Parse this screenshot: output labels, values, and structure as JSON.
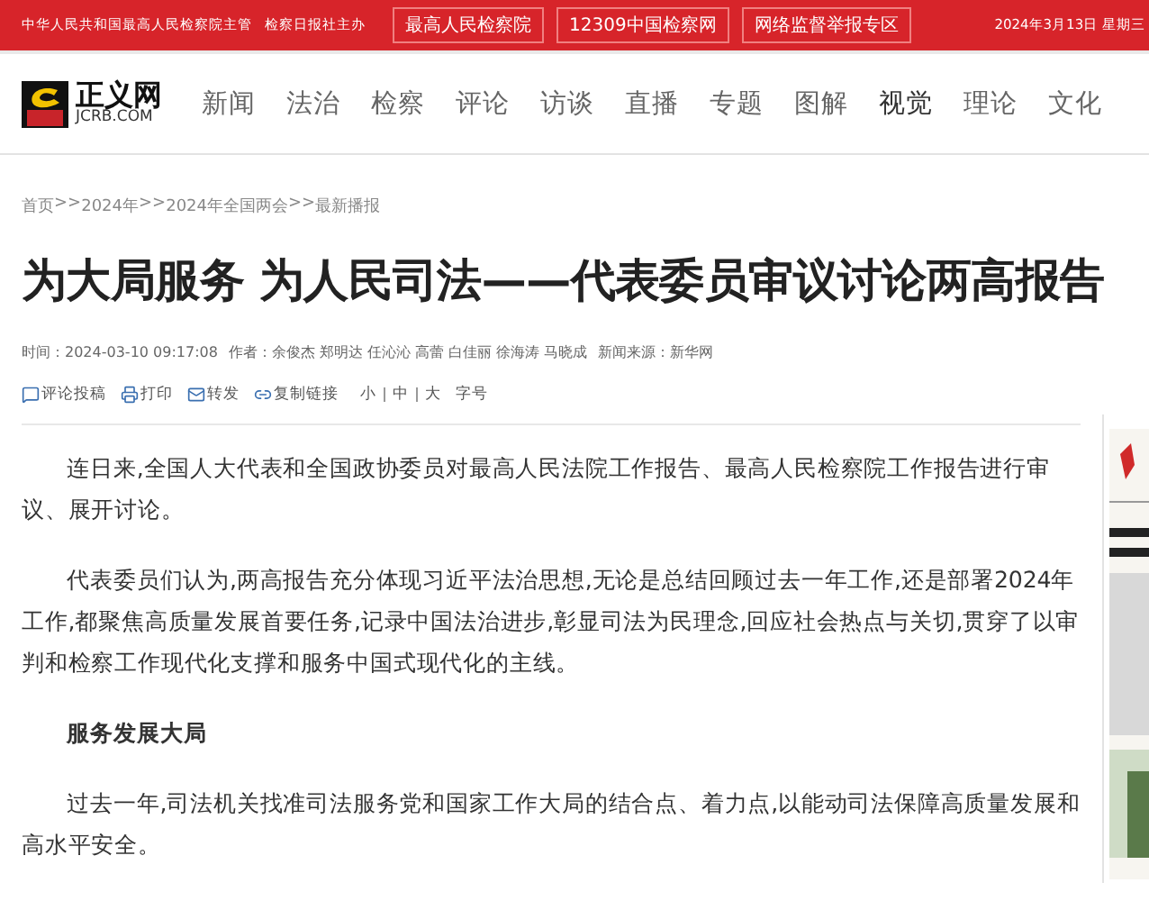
{
  "top_bar": {
    "texts": [
      "中华人民共和国最高人民检察院主管",
      "检察日报社主办"
    ],
    "links": [
      "最高人民检察院",
      "12309中国检察网",
      "网络监督举报专区"
    ],
    "date": "2024年3月13日 星期三"
  },
  "header": {
    "logo": {
      "name": "正义网",
      "domain": "JCRB.COM"
    },
    "nav": [
      {
        "label": "新闻",
        "selected": false
      },
      {
        "label": "法治",
        "selected": false
      },
      {
        "label": "检察",
        "selected": false
      },
      {
        "label": "评论",
        "selected": false
      },
      {
        "label": "访谈",
        "selected": false
      },
      {
        "label": "直播",
        "selected": false
      },
      {
        "label": "专题",
        "selected": false
      },
      {
        "label": "图解",
        "selected": false
      },
      {
        "label": "视觉",
        "selected": true
      },
      {
        "label": "理论",
        "selected": false
      },
      {
        "label": "文化",
        "selected": false
      }
    ]
  },
  "breadcrumb": [
    "首页",
    ">>",
    "2024年",
    ">>",
    "2024年全国两会",
    ">>",
    "最新播报"
  ],
  "article": {
    "title": "为大局服务 为人民司法——代表委员审议讨论两高报告",
    "meta": [
      "时间：2024-03-10 09:17:08",
      "作者：余俊杰 郑明达 任沁沁 高蕾 白佳丽 徐海涛 马晓成",
      "新闻来源：新华网"
    ],
    "tools": [
      {
        "kind": "comment",
        "label": "评论投稿"
      },
      {
        "kind": "print",
        "label": "打印"
      },
      {
        "kind": "mail",
        "label": "转发"
      },
      {
        "kind": "link",
        "label": "复制链接"
      }
    ],
    "font_sizes": [
      {
        "label": "小"
      },
      {
        "label": "中"
      },
      {
        "label": "大"
      }
    ],
    "font_size_label": "字号",
    "body": [
      {
        "kind": "para",
        "text": "连日来,全国人大代表和全国政协委员对最高人民法院工作报告、最高人民检察院工作报告进行审议、展开讨论。"
      },
      {
        "kind": "para",
        "text": "代表委员们认为,两高报告充分体现习近平法治思想,无论是总结回顾过去一年工作,还是部署2024年工作,都聚焦高质量发展首要任务,记录中国法治进步,彰显司法为民理念,回应社会热点与关切,贯穿了以审判和检察工作现代化支撑和服务中国式现代化的主线。"
      },
      {
        "kind": "heading",
        "text": "服务发展大局"
      },
      {
        "kind": "para",
        "text": "过去一年,司法机关找准司法服务党和国家工作大局的结合点、着力点,以能动司法保障高质量发展和高水平安全。"
      }
    ]
  }
}
